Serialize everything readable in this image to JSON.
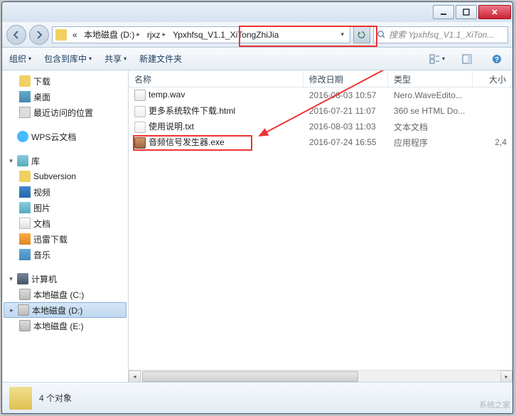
{
  "breadcrumb": {
    "seg1_prefix": "«",
    "seg1": "本地磁盘 (D:)",
    "seg2": "rjxz",
    "seg3": "Ypxhfsq_V1.1_XiTongZhiJia"
  },
  "search": {
    "placeholder": "搜索 Ypxhfsq_V1.1_XiTon..."
  },
  "toolbar": {
    "organize": "组织",
    "include": "包含到库中",
    "share": "共享",
    "newfolder": "新建文件夹"
  },
  "sidebar": {
    "downloads": "下载",
    "desktop": "桌面",
    "recent": "最近访问的位置",
    "wps": "WPS云文档",
    "library": "库",
    "subversion": "Subversion",
    "videos": "视频",
    "pictures": "图片",
    "documents": "文档",
    "xunlei": "迅雷下载",
    "music": "音乐",
    "computer": "计算机",
    "driveC": "本地磁盘 (C:)",
    "driveD": "本地磁盘 (D:)",
    "driveE": "本地磁盘 (E:)"
  },
  "columns": {
    "name": "名称",
    "date": "修改日期",
    "type": "类型",
    "size": "大小"
  },
  "files": [
    {
      "name": "temp.wav",
      "date": "2016-08-03 10:57",
      "type": "Nero.WaveEdito...",
      "size": "",
      "icon": "doc"
    },
    {
      "name": "更多系统软件下载.html",
      "date": "2016-07-21 11:07",
      "type": "360 se HTML Do...",
      "size": "",
      "icon": "html"
    },
    {
      "name": "使用说明.txt",
      "date": "2016-08-03 11:03",
      "type": "文本文档",
      "size": "",
      "icon": "txt"
    },
    {
      "name": "音频信号发生器.exe",
      "date": "2016-07-24 16:55",
      "type": "应用程序",
      "size": "2,4",
      "icon": "exe"
    }
  ],
  "status": {
    "count": "4 个对象"
  },
  "watermark": "系统之家"
}
